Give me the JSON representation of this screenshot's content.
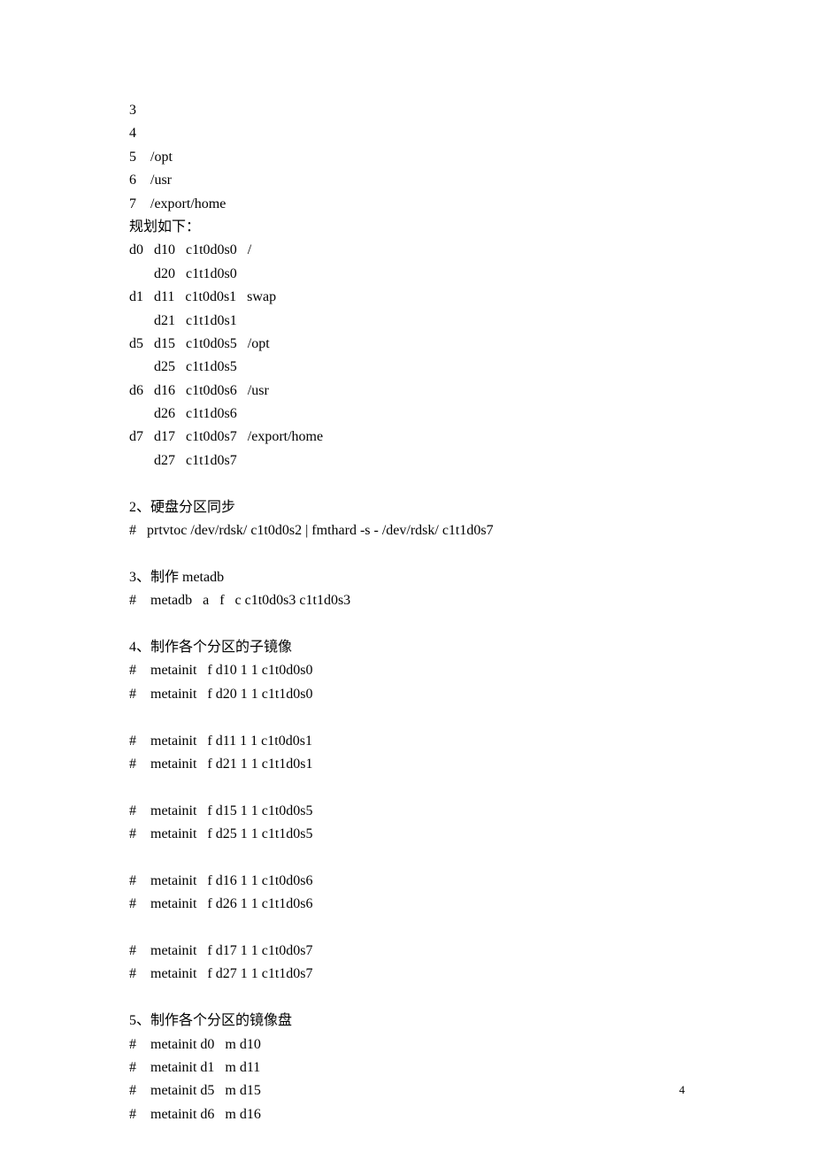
{
  "lines": [
    "3",
    "4",
    "5    /opt",
    "6    /usr",
    "7    /export/home",
    "规划如下：",
    "d0   d10   c1t0d0s0   /",
    "       d20   c1t1d0s0",
    "d1   d11   c1t0d0s1   swap",
    "       d21   c1t1d0s1",
    "d5   d15   c1t0d0s5   /opt",
    "       d25   c1t1d0s5",
    "d6   d16   c1t0d0s6   /usr",
    "       d26   c1t1d0s6",
    "d7   d17   c1t0d0s7   /export/home",
    "       d27   c1t1d0s7",
    "",
    "2、硬盘分区同步",
    "#   prtvtoc /dev/rdsk/ c1t0d0s2 | fmthard -s - /dev/rdsk/ c1t1d0s7",
    "",
    "3、制作 metadb",
    "#    metadb   a   f   c c1t0d0s3 c1t1d0s3",
    "",
    "4、制作各个分区的子镜像",
    "#    metainit   f d10 1 1 c1t0d0s0",
    "#    metainit   f d20 1 1 c1t1d0s0",
    "",
    "#    metainit   f d11 1 1 c1t0d0s1",
    "#    metainit   f d21 1 1 c1t1d0s1",
    "",
    "#    metainit   f d15 1 1 c1t0d0s5",
    "#    metainit   f d25 1 1 c1t1d0s5",
    "",
    "#    metainit   f d16 1 1 c1t0d0s6",
    "#    metainit   f d26 1 1 c1t1d0s6",
    "",
    "#    metainit   f d17 1 1 c1t0d0s7",
    "#    metainit   f d27 1 1 c1t1d0s7",
    "",
    "5、制作各个分区的镜像盘",
    "#    metainit d0   m d10",
    "#    metainit d1   m d11",
    "#    metainit d5   m d15",
    "#    metainit d6   m d16"
  ],
  "page_number": "4"
}
